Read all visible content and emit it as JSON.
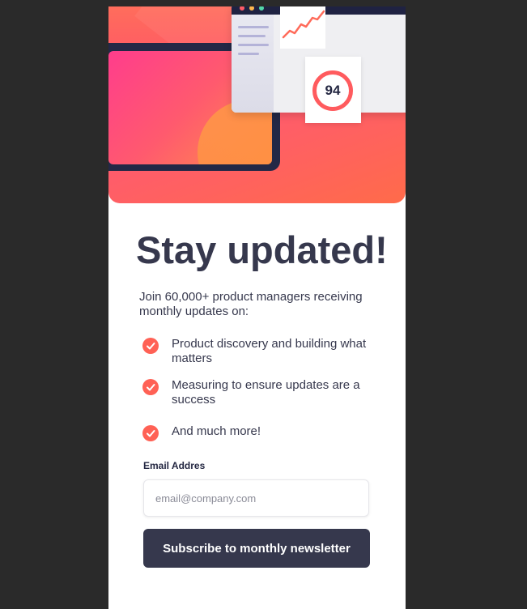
{
  "hero": {
    "score": "94"
  },
  "signup": {
    "title": "Stay updated!",
    "intro": "Join 60,000+ product managers receiving monthly updates on:",
    "features": [
      {
        "text": "Product discovery and building what matters",
        "icon": "check-icon"
      },
      {
        "text": "Measuring to ensure updates are a success",
        "icon": "check-icon"
      },
      {
        "text": "And much more!",
        "icon": "check-icon"
      }
    ],
    "email_label": "Email Addres",
    "email_placeholder": "email@company.com",
    "email_value": "",
    "submit_label": "Subscribe to monthly newsletter"
  },
  "colors": {
    "page_background": "#2a2a2a",
    "card_background": "#ffffff",
    "accent": "#ff6155",
    "text_dark": "#36384d",
    "button_background": "#36384d",
    "button_text": "#ffffff"
  }
}
